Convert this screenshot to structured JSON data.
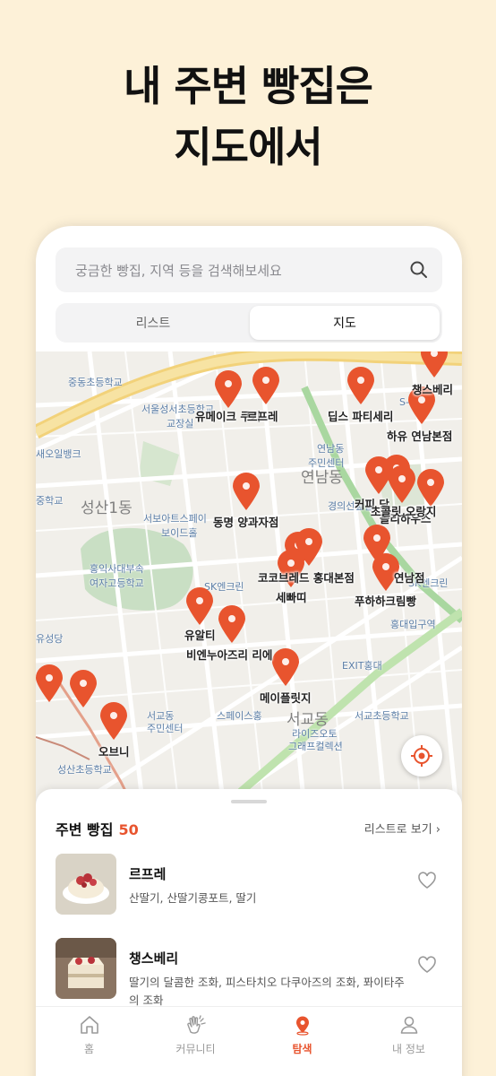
{
  "headline": {
    "line1": "내 주변 빵집은",
    "line2": "지도에서"
  },
  "search": {
    "placeholder": "궁금한 빵집, 지역 등을 검색해보세요"
  },
  "view_tabs": [
    {
      "label": "리스트",
      "active": false
    },
    {
      "label": "지도",
      "active": true
    }
  ],
  "map": {
    "bakery_labels": [
      "유메이크 쿠키",
      "르프레",
      "딥스 파티세리",
      "챙스베리",
      "하유 연남본점",
      "동명 양과자점",
      "코코브레드 홍대본점",
      "세빠띠",
      "유알티",
      "비엔누아즈리 리에",
      "메이플릿지",
      "푸하하크림빵",
      "오브니",
      "올리하우스",
      "연남점",
      "커피 당",
      "초콜릿 오랑지"
    ],
    "place_labels": [
      "중동초등학교",
      "서울성서초등학교",
      "교장실",
      "새오일뱅크",
      "연남동",
      "주민센터",
      "중학교",
      "서보아트스페이",
      "보이드홀",
      "홍익사대부속",
      "여자고등학교",
      "SK엔크린",
      "경의선숲길",
      "유성당",
      "서교동",
      "주민센터",
      "스페이스홍",
      "서교초등학교",
      "라이즈오토",
      "그래프컬렉션",
      "EXIT홍대",
      "홍대입구역",
      "성산초등학교",
      "SK엔크린",
      "S-OIL"
    ],
    "district_labels": [
      "성산1동",
      "연남동",
      "서교동"
    ]
  },
  "sheet": {
    "title": "주변 빵집",
    "count": "50",
    "more": "리스트로 보기 ›",
    "items": [
      {
        "name": "르프레",
        "desc": "산딸기, 산딸기콩포트, 딸기",
        "liked": false
      },
      {
        "name": "챙스베리",
        "desc": "딸기의 달콤한 조화, 피스타치오 다쿠아즈의 조화, 퐈이타주의 조화",
        "liked": false
      }
    ]
  },
  "tabbar": [
    {
      "label": "홈",
      "icon": "home-icon",
      "active": false
    },
    {
      "label": "커뮤니티",
      "icon": "clap-hands-icon",
      "active": false
    },
    {
      "label": "탐색",
      "icon": "map-pin-icon",
      "active": true
    },
    {
      "label": "내 정보",
      "icon": "person-icon",
      "active": false
    }
  ],
  "colors": {
    "accent": "#e8542e",
    "background": "#fdf1d8",
    "pin": "#e8542e"
  }
}
